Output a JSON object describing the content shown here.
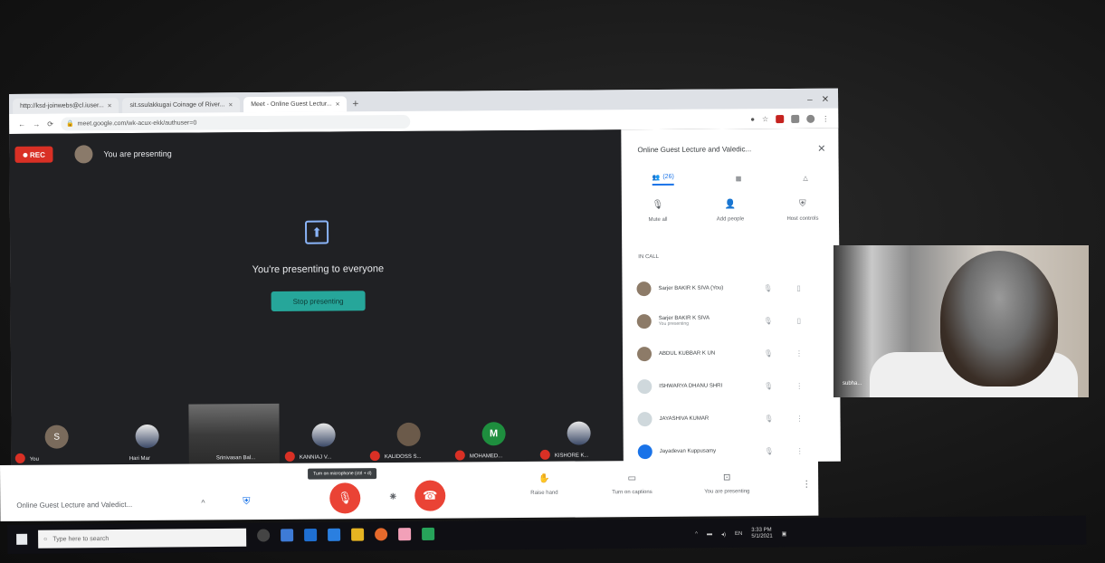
{
  "browser": {
    "tabs": [
      {
        "label": "http://ksd-joinwebs@cl.iuser..."
      },
      {
        "label": "sit.ssulakkugai Coinage of River..."
      },
      {
        "label": "Meet - Online Guest Lectur..."
      }
    ],
    "url": "meet.google.com/wk-acux-ekk/authuser=0"
  },
  "meet": {
    "rec_label": "REC",
    "presenting_label": "You are presenting",
    "presenting_message": "You're presenting to everyone",
    "stop_button": "Stop presenting",
    "tiles": [
      {
        "name": "You",
        "kind": "initial",
        "initial": "S"
      },
      {
        "name": "Hari Mar",
        "kind": "photo"
      },
      {
        "name": "Srinivasan Bal...",
        "kind": "video"
      },
      {
        "name": "KANNIAJ V...",
        "kind": "photo"
      },
      {
        "name": "KALIDOSS S...",
        "kind": "brown"
      },
      {
        "name": "MOHAMED...",
        "kind": "green",
        "initial": "M"
      },
      {
        "name": "KISHORE K...",
        "kind": "photo"
      }
    ],
    "meeting_title": "Online Guest Lecture and Valedict...",
    "tooltip": "Turn on microphone (ctrl + d)",
    "raise_hand": "Raise hand",
    "captions": "Turn on captions",
    "present_now": "You are presenting"
  },
  "panel": {
    "title": "Online Guest Lecture and Valedic...",
    "tabs": [
      {
        "label": "(26)",
        "icon": "people-icon"
      },
      {
        "label": "",
        "icon": "chat-icon"
      },
      {
        "label": "",
        "icon": "activities-icon"
      }
    ],
    "actions": [
      {
        "label": "Mute all",
        "icon": "mic-off-icon"
      },
      {
        "label": "Add people",
        "icon": "person-add-icon"
      },
      {
        "label": "Host controls",
        "icon": "shield-icon"
      }
    ],
    "section_label": "IN CALL",
    "participants": [
      {
        "name": "Sarjer BAKIR K SIVA (You)",
        "sub": "",
        "avatar": "brown"
      },
      {
        "name": "Sarjer BAKIR K SIVA",
        "sub": "You presenting",
        "avatar": "brown"
      },
      {
        "name": "ABDUL KUBBAR K UN",
        "sub": "",
        "avatar": "brown"
      },
      {
        "name": "ISHWARYA DHANU SHRI",
        "sub": "",
        "avatar": "light"
      },
      {
        "name": "JAYASHIVA KUMAR",
        "sub": "",
        "avatar": "light"
      },
      {
        "name": "Jayadevan Kuppusamy",
        "sub": "",
        "avatar": "blue"
      }
    ]
  },
  "webcam": {
    "name": "subha..."
  },
  "taskbar": {
    "search_placeholder": "Type here to search",
    "time": "3:33 PM",
    "date": "5/1/2021"
  }
}
